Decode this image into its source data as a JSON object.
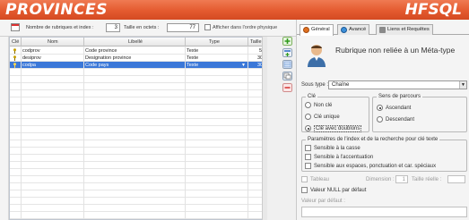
{
  "header": {
    "left_title": "PROVINCES",
    "right_title": "HFSQL"
  },
  "toolbar": {
    "count_label": "Nombre de rubriques et index :",
    "count_value": "3",
    "size_label": "Taille en octets :",
    "size_value": "77",
    "physical_order_label": "Afficher dans l'ordre physique"
  },
  "grid": {
    "columns": [
      "Clé",
      "Nom",
      "Libellé",
      "Type",
      "Taille"
    ],
    "rows": [
      {
        "nom": "codprov",
        "libelle": "Code province",
        "type": "Texte",
        "taille": "5"
      },
      {
        "nom": "desiprov",
        "libelle": "Designation province",
        "type": "Texte",
        "taille": "30"
      },
      {
        "nom": "codpa",
        "libelle": "Code pays",
        "type": "Texte",
        "taille": "30"
      }
    ]
  },
  "pane": {
    "tabs": [
      "Général",
      "Avancé",
      "Liens et Requêtes"
    ],
    "title": "Rubrique non reliée à un Méta-type",
    "subtype_label": "Sous type :",
    "subtype_value": "Chaîne",
    "key_group_title": "Clé",
    "key_options": [
      "Non clé",
      "Clé unique",
      "Clé avec doublons"
    ],
    "path_group_title": "Sens de parcours",
    "path_options": [
      "Ascendant",
      "Descendant"
    ],
    "search_group_title": "Paramètres de l'index et de la recherche pour clé texte",
    "search_options": [
      "Sensible à la casse",
      "Sensible à l'accentuation",
      "Sensible aux espaces, ponctuation et car. spéciaux"
    ],
    "array_label": "Tableau",
    "dimension_label": "Dimension :",
    "dimension_value": "1",
    "real_size_label": "Taille réelle :",
    "null_label": "Valeur NULL par défaut",
    "default_label": "Valeur par défaut :"
  },
  "colors": {
    "header_accent": "#e45a2f",
    "selection": "#3b78d8"
  }
}
